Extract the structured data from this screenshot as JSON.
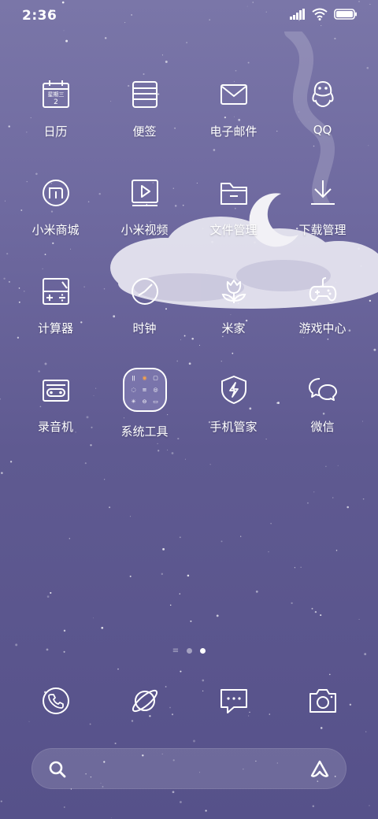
{
  "status_bar": {
    "time": "2:36"
  },
  "apps": [
    {
      "label": "日历",
      "icon": "calendar-icon",
      "calendar_text": "星期三",
      "calendar_day": "2"
    },
    {
      "label": "便签",
      "icon": "notes-icon"
    },
    {
      "label": "电子邮件",
      "icon": "mail-icon"
    },
    {
      "label": "QQ",
      "icon": "qq-icon"
    },
    {
      "label": "小米商城",
      "icon": "mi-store-icon"
    },
    {
      "label": "小米视频",
      "icon": "video-icon"
    },
    {
      "label": "文件管理",
      "icon": "folder-icon"
    },
    {
      "label": "下载管理",
      "icon": "download-icon"
    },
    {
      "label": "计算器",
      "icon": "calculator-icon"
    },
    {
      "label": "时钟",
      "icon": "clock-icon"
    },
    {
      "label": "米家",
      "icon": "mijia-icon"
    },
    {
      "label": "游戏中心",
      "icon": "gamepad-icon"
    },
    {
      "label": "录音机",
      "icon": "recorder-icon"
    },
    {
      "label": "系统工具",
      "icon": "system-tools-folder-icon"
    },
    {
      "label": "手机管家",
      "icon": "security-shield-icon"
    },
    {
      "label": "微信",
      "icon": "wechat-icon"
    }
  ],
  "page_indicator": {
    "pages": 2,
    "current": 2
  },
  "dock": [
    {
      "icon": "phone-icon"
    },
    {
      "icon": "browser-planet-icon"
    },
    {
      "icon": "messages-icon"
    },
    {
      "icon": "camera-icon"
    }
  ],
  "search_bar": {
    "left_icon": "search-icon",
    "right_icon": "assistant-icon"
  },
  "colors": {
    "background_top": "#7a76a8",
    "background_bottom": "#56518a",
    "icon_stroke": "#ffffff"
  }
}
